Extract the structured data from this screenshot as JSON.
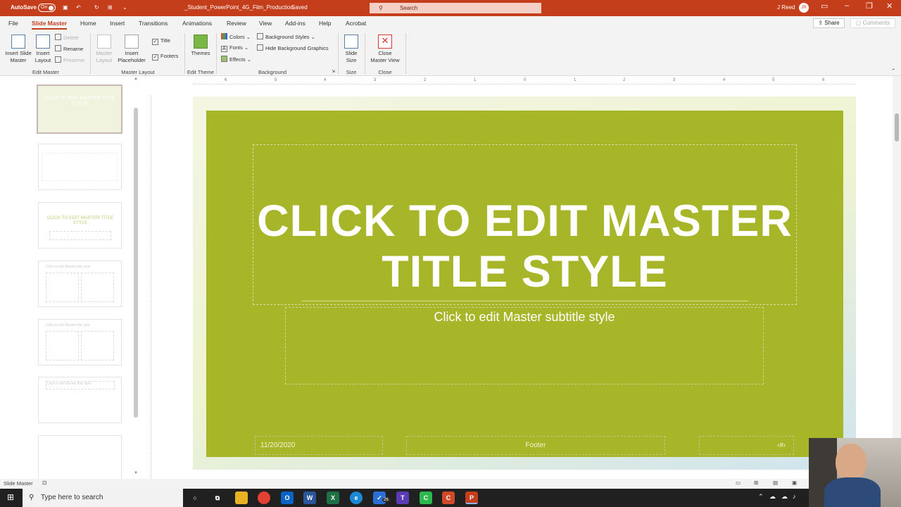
{
  "titlebar": {
    "autosave_label": "AutoSave",
    "autosave_state": "On",
    "file_title": "_Student_PowerPoint_4G_Film_Production",
    "saved_status": "Saved",
    "search_placeholder": "Search",
    "user_name": "J Reed",
    "user_initials": "JR"
  },
  "ribbon_tabs": [
    "File",
    "Slide Master",
    "Home",
    "Insert",
    "Transitions",
    "Animations",
    "Review",
    "View",
    "Add-ins",
    "Help",
    "Acrobat"
  ],
  "share_label": "Share",
  "comments_label": "Comments",
  "ribbon": {
    "insert_slide_master": "Insert Slide\nMaster",
    "insert_layout": "Insert\nLayout",
    "delete": "Delete",
    "rename": "Rename",
    "preserve": "Preserve",
    "group_edit_master": "Edit Master",
    "master_layout_btn": "Master\nLayout",
    "insert_placeholder": "Insert\nPlaceholder",
    "title_check": "Title",
    "footers_check": "Footers",
    "group_master_layout": "Master Layout",
    "themes": "Themes",
    "group_edit_theme": "Edit Theme",
    "colors": "Colors",
    "fonts": "Fonts",
    "effects": "Effects",
    "background_styles": "Background Styles",
    "hide_background_graphics": "Hide Background Graphics",
    "group_background": "Background",
    "slide_size": "Slide\nSize",
    "group_size": "Size",
    "close_master_view": "Close\nMaster View",
    "group_close": "Close"
  },
  "thumbnails": [
    {
      "text": "CLICK TO EDIT MASTER TITLE STYLE"
    },
    {
      "text": ""
    },
    {
      "text": "CLICK TO EDIT MASTER TITLE STYLE"
    },
    {
      "text": "Click to edit Master title style"
    },
    {
      "text": "Click to edit Master title style"
    },
    {
      "text": "Click to edit Master title style"
    },
    {
      "text": ""
    }
  ],
  "ruler_ticks": [
    "6",
    "5",
    "4",
    "3",
    "2",
    "1",
    "0",
    "1",
    "2",
    "3",
    "4",
    "5",
    "6"
  ],
  "slide": {
    "title": "CLICK TO EDIT MASTER TITLE STYLE",
    "subtitle": "Click to edit Master subtitle style",
    "date": "11/20/2020",
    "footer": "Footer",
    "slide_number": "‹#›"
  },
  "status": {
    "view_name": "Slide Master"
  },
  "taskbar": {
    "search_placeholder": "Type here to search",
    "badge": "26"
  },
  "colors": {
    "accent": "#c43e1c",
    "slide_green": "#a7b528"
  }
}
